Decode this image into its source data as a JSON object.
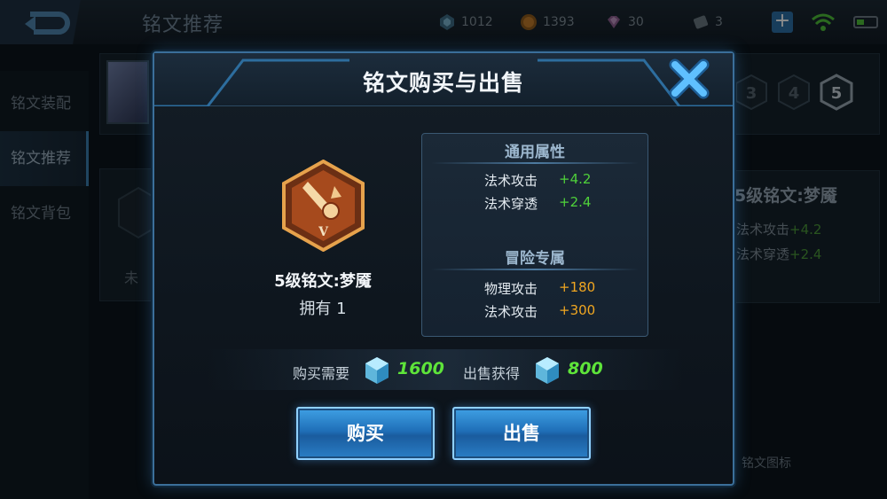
{
  "header": {
    "page_title": "铭文推荐",
    "resources": [
      {
        "icon": "diamond-crystal-icon",
        "value": "1012"
      },
      {
        "icon": "gold-coin-icon",
        "value": "1393"
      },
      {
        "icon": "gem-icon",
        "value": "30"
      },
      {
        "icon": "ticket-icon",
        "value": "3"
      }
    ]
  },
  "sidebar": {
    "items": [
      {
        "label": "铭文装配"
      },
      {
        "label": "铭文推荐"
      },
      {
        "label": "铭文背包"
      }
    ]
  },
  "background": {
    "slot_numbers": [
      "3",
      "4",
      "5"
    ],
    "side_title": "5级铭文:梦魇",
    "side_lines": [
      {
        "name": "法术攻击",
        "value": "+4.2"
      },
      {
        "name": "法术穿透",
        "value": "+2.4"
      }
    ],
    "bottom_text": "铭文图标",
    "left_text": "未"
  },
  "modal": {
    "title": "铭文购买与出售",
    "rune": {
      "level_mark": "V",
      "name": "5级铭文:梦魇",
      "owned": "拥有 1"
    },
    "general_attributes": {
      "heading": "通用属性",
      "rows": [
        {
          "name": "法术攻击",
          "value": "+4.2"
        },
        {
          "name": "法术穿透",
          "value": "+2.4"
        }
      ]
    },
    "adventure_attributes": {
      "heading": "冒险专属",
      "rows": [
        {
          "name": "物理攻击",
          "value": "+180"
        },
        {
          "name": "法术攻击",
          "value": "+300"
        }
      ]
    },
    "buy_price_label": "购买需要",
    "buy_price": "1600",
    "sell_price_label": "出售获得",
    "sell_price": "800",
    "buy_button": "购买",
    "sell_button": "出售"
  },
  "colors": {
    "accent": "#3b7fb0",
    "positive": "#4fd13a",
    "adventure": "#f0a621",
    "button": "#1f6fb8"
  }
}
